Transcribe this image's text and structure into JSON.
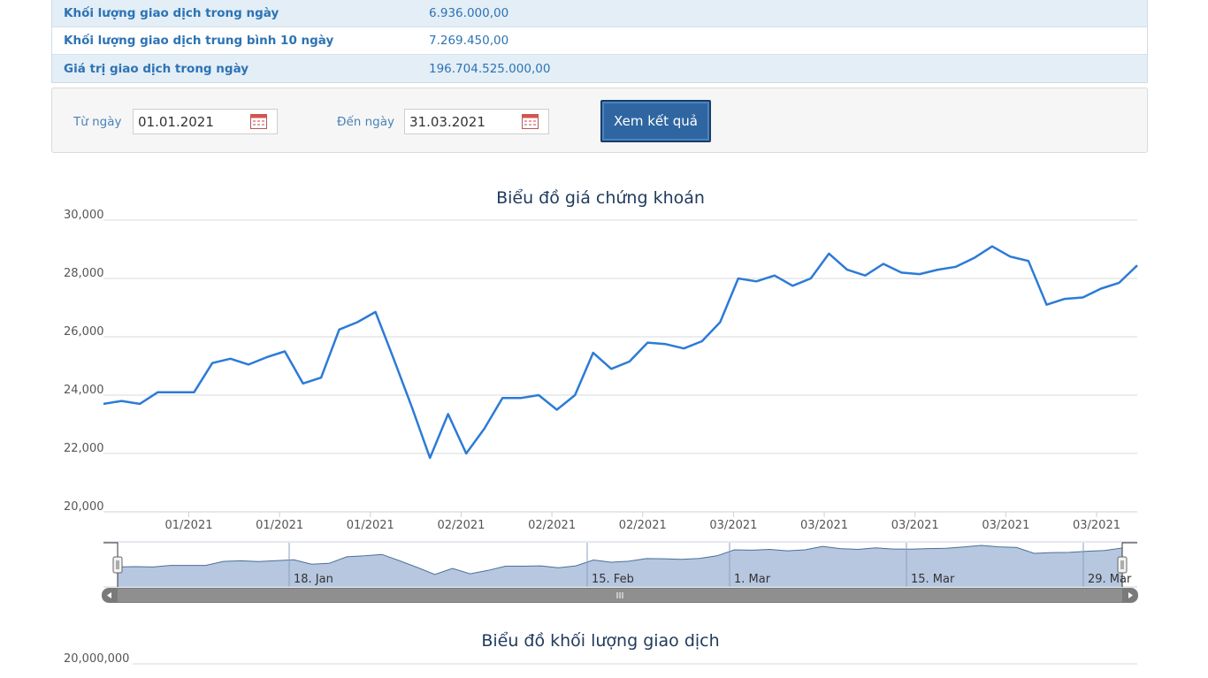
{
  "stats": [
    {
      "label": "Khối lượng giao dịch trong ngày",
      "value": "6.936.000,00"
    },
    {
      "label": "Khối lượng giao dịch trung bình 10 ngày",
      "value": "7.269.450,00"
    },
    {
      "label": "Giá trị giao dịch trong ngày",
      "value": "196.704.525.000,00"
    }
  ],
  "filter": {
    "from_label": "Từ ngày",
    "from_value": "01.01.2021",
    "to_label": "Đến ngày",
    "to_value": "31.03.2021",
    "submit_label": "Xem kết quả"
  },
  "colors": {
    "line": "#2c7bd6",
    "navigator_fill": "#b6c7df",
    "accent": "#2f66a1"
  },
  "chart_data": {
    "type": "line",
    "title": "Biểu đồ giá chứng khoán",
    "xlabel": "",
    "ylabel": "",
    "ylim": [
      20000,
      30000
    ],
    "yticks": [
      "20,000",
      "22,000",
      "24,000",
      "26,000",
      "28,000",
      "30,000"
    ],
    "xticks": [
      "01/2021",
      "01/2021",
      "01/2021",
      "02/2021",
      "02/2021",
      "02/2021",
      "03/2021",
      "03/2021",
      "03/2021",
      "03/2021",
      "03/2021"
    ],
    "navigator_ticks": [
      "18. Jan",
      "15. Feb",
      "1. Mar",
      "15. Mar",
      "29. Mar"
    ],
    "grid": true,
    "legend": "none",
    "values": [
      23700,
      23800,
      23700,
      24100,
      24100,
      24100,
      25100,
      25250,
      25050,
      25300,
      25500,
      24400,
      24600,
      26250,
      26500,
      26850,
      25250,
      23600,
      21850,
      23350,
      22000,
      22850,
      23900,
      23900,
      24000,
      23500,
      24000,
      25450,
      24900,
      25150,
      25800,
      25750,
      25600,
      25850,
      26500,
      28000,
      27900,
      28100,
      27750,
      28000,
      28850,
      28300,
      28100,
      28500,
      28200,
      28150,
      28300,
      28400,
      28700,
      29100,
      28750,
      28600,
      27100,
      27300,
      27350,
      27650,
      27850,
      28450
    ]
  },
  "volume_chart": {
    "title": "Biểu đồ khối lượng giao dịch",
    "ytick_top": "20,000,000"
  }
}
